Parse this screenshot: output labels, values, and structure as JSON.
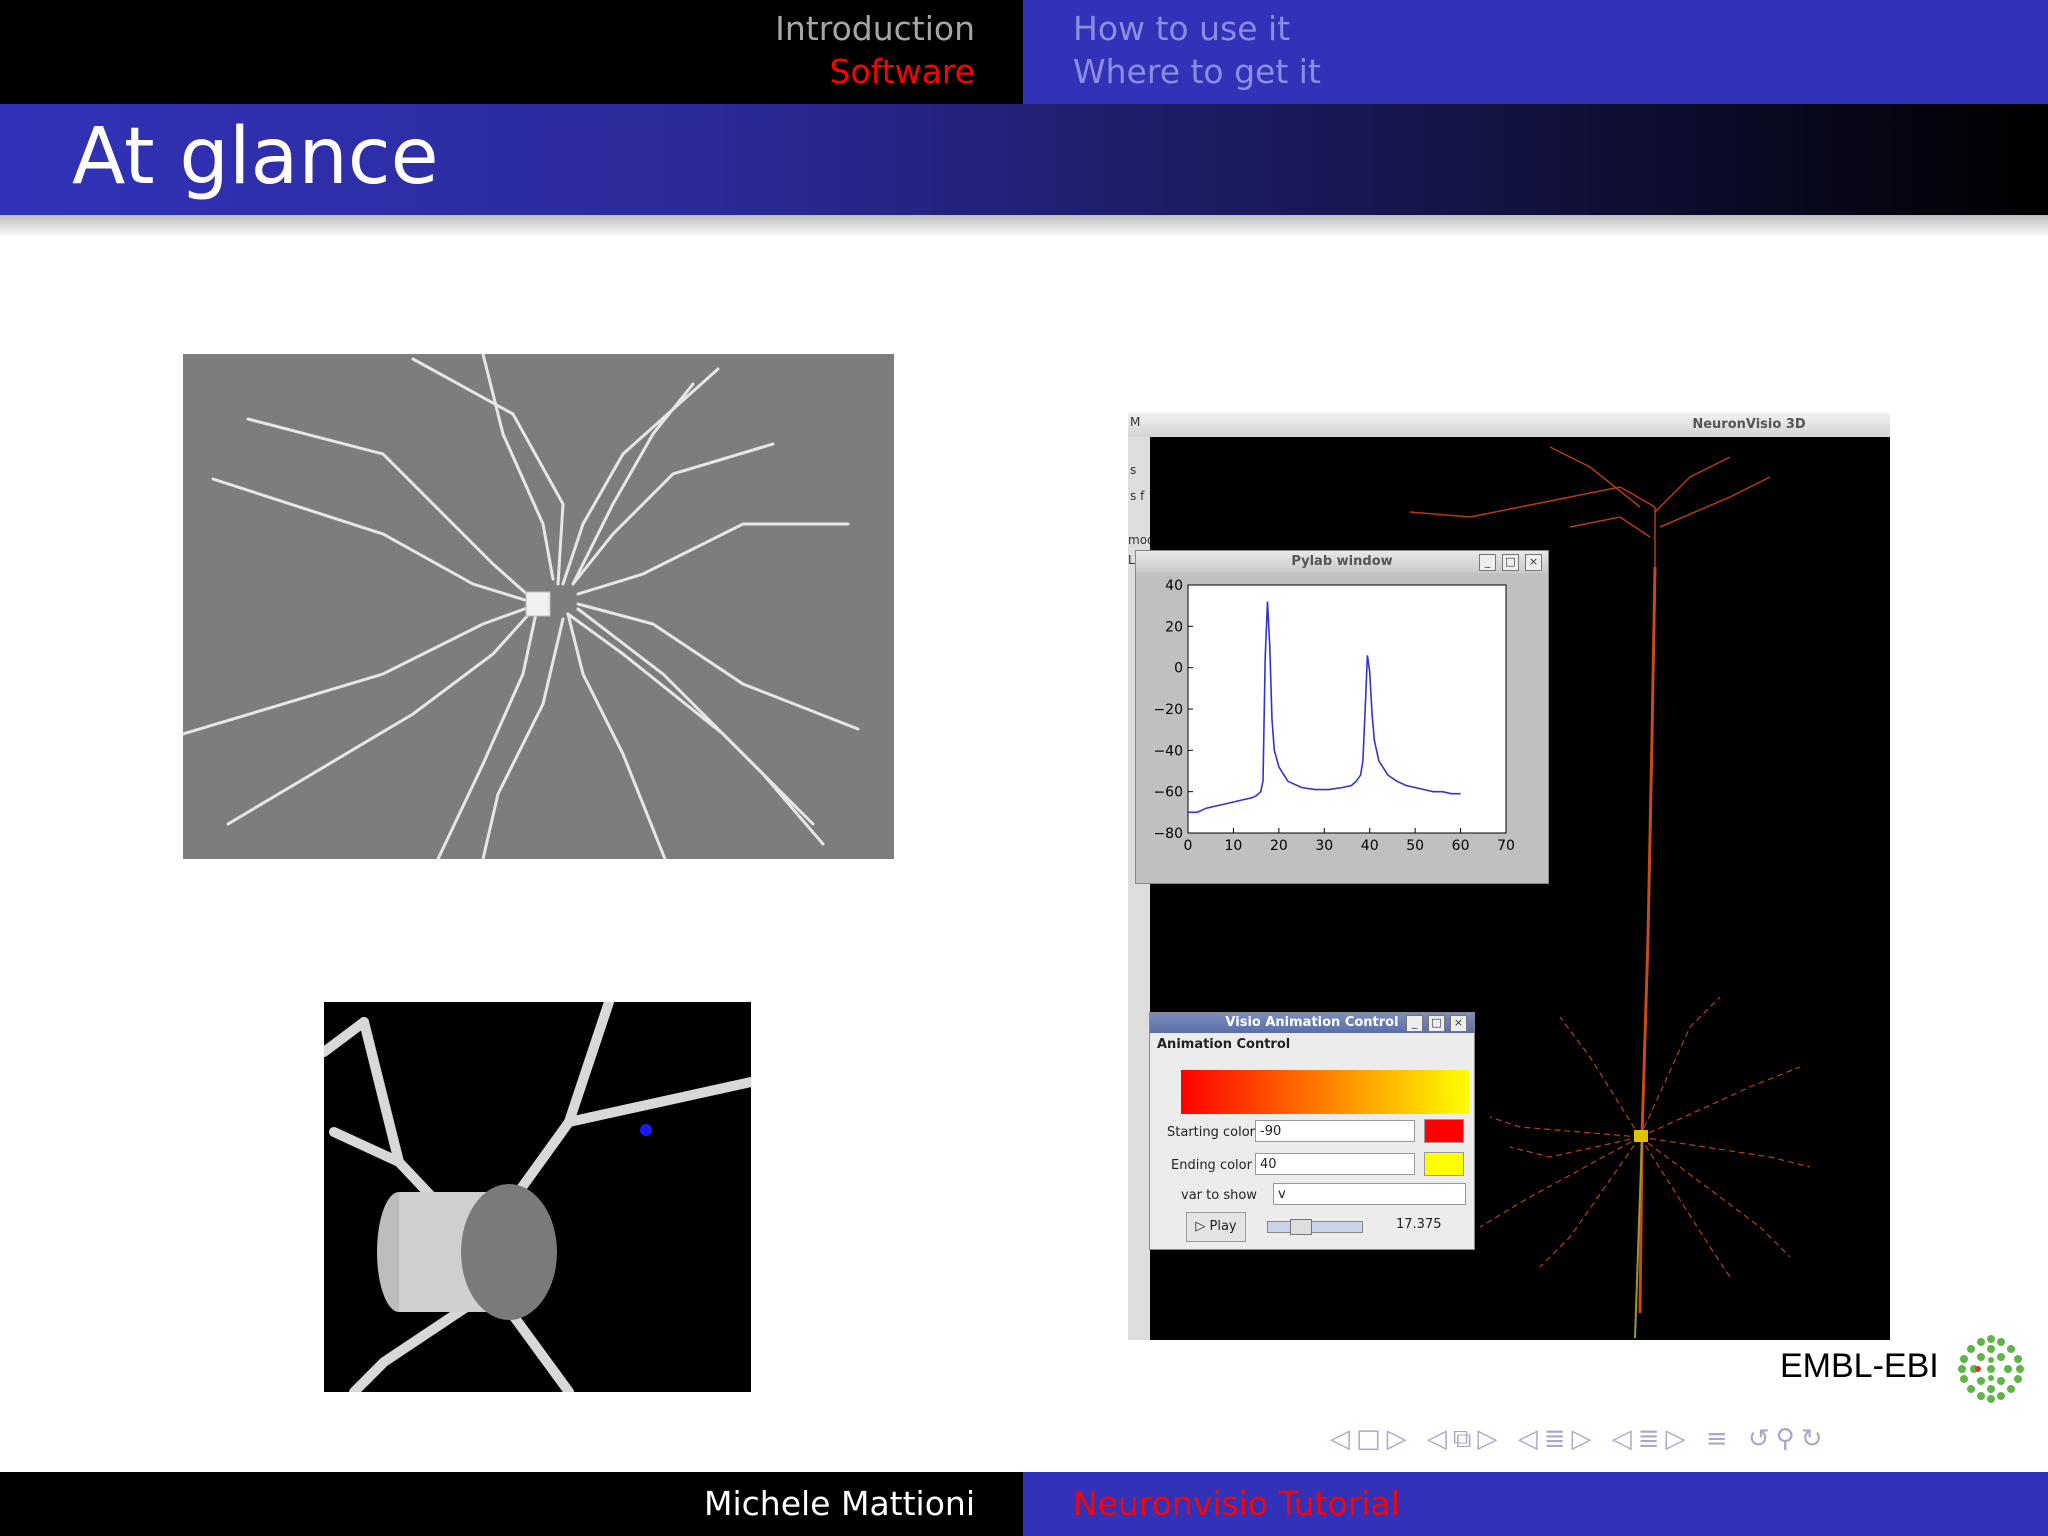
{
  "header": {
    "sections_left": [
      "Introduction",
      "Software"
    ],
    "sections_right": [
      "How to use it",
      "Where to get it"
    ],
    "active_color": "#ff0000",
    "inactive_color_left": "#a6a6a6",
    "inactive_color_right": "#8c8ce0"
  },
  "slide": {
    "title": "At glance"
  },
  "neuronvisio_window": {
    "title": "NeuronVisio 3D",
    "left_panel_fragments": [
      "M",
      "s",
      "s f",
      "mod",
      "L"
    ]
  },
  "pylab_window": {
    "title": "Pylab window",
    "chart_data": {
      "type": "line",
      "x": [
        0,
        1,
        2,
        4,
        6,
        8,
        10,
        12,
        14,
        15,
        16,
        16.5,
        17,
        17.5,
        18,
        18.5,
        19,
        20,
        22,
        25,
        28,
        31,
        34,
        36,
        37,
        38,
        38.5,
        39,
        39.5,
        40,
        40.5,
        41,
        42,
        44,
        46,
        48,
        50,
        52,
        54,
        56,
        58,
        60
      ],
      "series": [
        {
          "values": [
            -70,
            -70,
            -70,
            -68,
            -67,
            -66,
            -65,
            -64,
            -63,
            -62,
            -60,
            -55,
            5,
            32,
            10,
            -25,
            -40,
            -48,
            -55,
            -58,
            -59,
            -59,
            -58,
            -57,
            -55,
            -52,
            -45,
            -20,
            6,
            -2,
            -22,
            -35,
            -45,
            -52,
            -55,
            -57,
            -58,
            -59,
            -60,
            -60,
            -61,
            -61
          ]
        }
      ],
      "xlim": [
        0,
        70
      ],
      "ylim": [
        -80,
        40
      ],
      "xticks": [
        "0",
        "10",
        "20",
        "30",
        "40",
        "50",
        "60",
        "70"
      ],
      "yticks": [
        "40",
        "20",
        "0",
        "−20",
        "−40",
        "−60",
        "−80"
      ],
      "line_color": "#3333cc"
    }
  },
  "animation_window": {
    "title": "Visio Animation Control",
    "header": "Animation Control",
    "starting_label": "Starting color",
    "starting_value": "-90",
    "starting_color": "#ff0000",
    "ending_label": "Ending color",
    "ending_value": "40",
    "ending_color": "#ffff00",
    "var_label": "var to show",
    "var_value": "v",
    "play_label": "Play",
    "time_value": "17.375"
  },
  "logo": {
    "text": "EMBL-EBI"
  },
  "footer": {
    "author": "Michele Mattioni",
    "title": "Neuronvisio Tutorial"
  }
}
